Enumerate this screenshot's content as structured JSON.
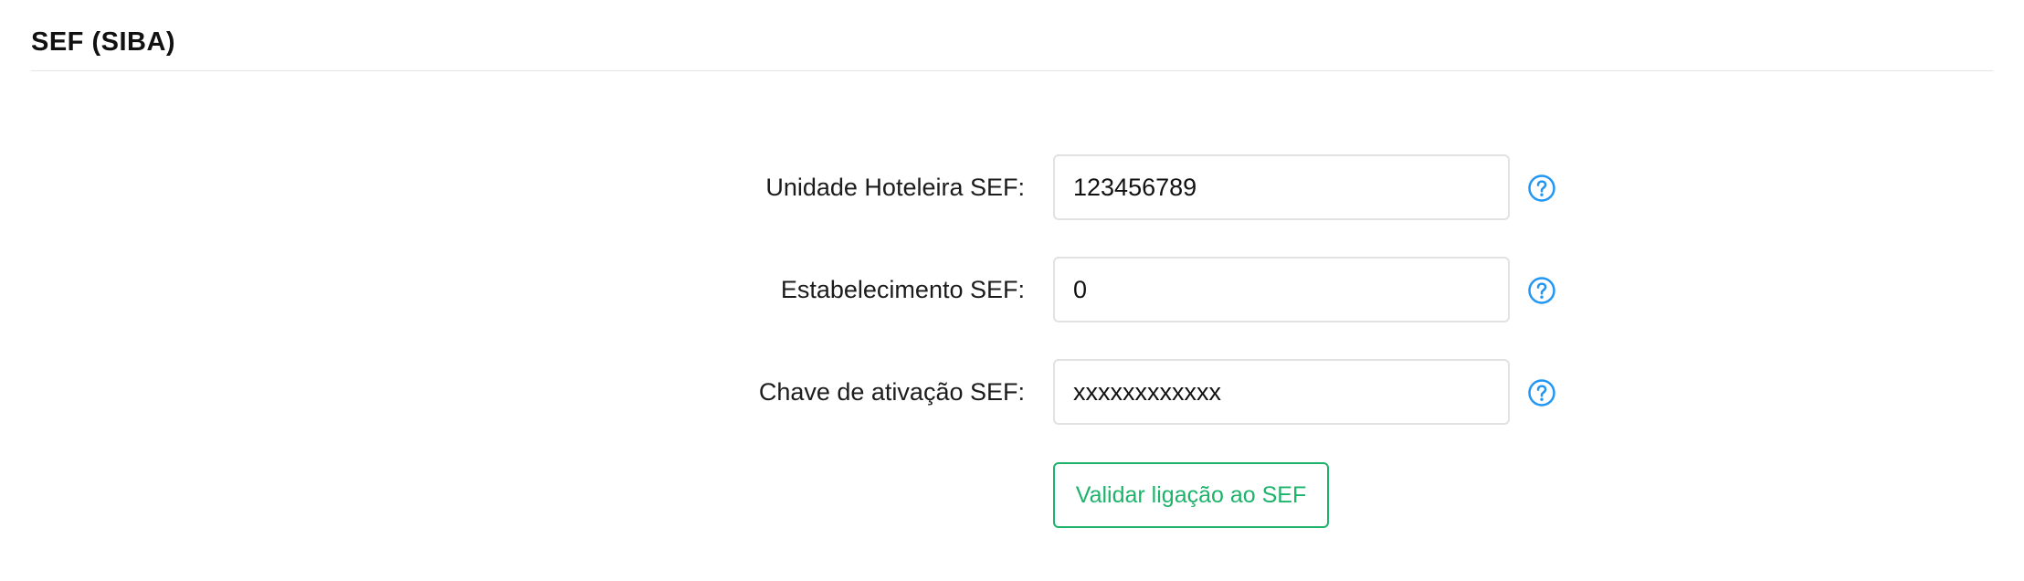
{
  "section": {
    "title": "SEF (SIBA)"
  },
  "form": {
    "fields": [
      {
        "label": "Unidade Hoteleira SEF:",
        "value": "123456789",
        "help_icon": "question-circle-icon"
      },
      {
        "label": "Estabelecimento SEF:",
        "value": "0",
        "help_icon": "question-circle-icon"
      },
      {
        "label": "Chave de ativação SEF:",
        "value": "xxxxxxxxxxxx",
        "help_icon": "question-circle-icon"
      }
    ],
    "validate_button_label": "Validar ligação ao SEF"
  },
  "colors": {
    "accent_green": "#1db36b",
    "help_icon_blue": "#2196f3",
    "input_border": "#e2e2e2",
    "divider": "#e3e3e3"
  }
}
